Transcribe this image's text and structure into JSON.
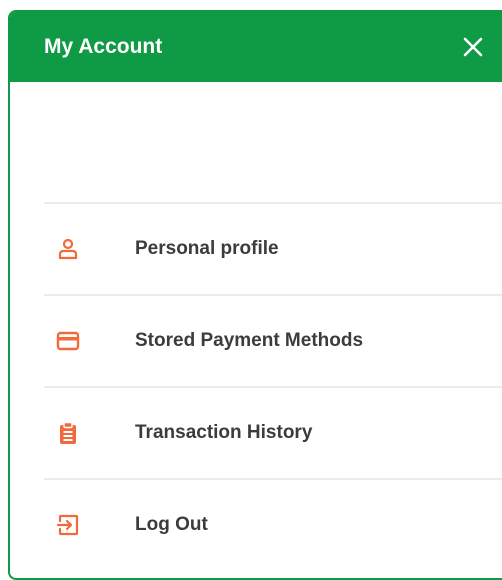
{
  "header": {
    "title": "My Account",
    "close_icon": "close-icon"
  },
  "menu": {
    "items": [
      {
        "label": "Personal profile",
        "icon": "user-icon"
      },
      {
        "label": "Stored Payment Methods",
        "icon": "credit-card-icon"
      },
      {
        "label": "Transaction History",
        "icon": "clipboard-icon"
      },
      {
        "label": "Log Out",
        "icon": "logout-icon"
      }
    ]
  },
  "colors": {
    "header_bg": "#0f9a45",
    "accent_icon": "#f26a3b",
    "label_text": "#3c3c3c",
    "divider": "#ececec"
  }
}
